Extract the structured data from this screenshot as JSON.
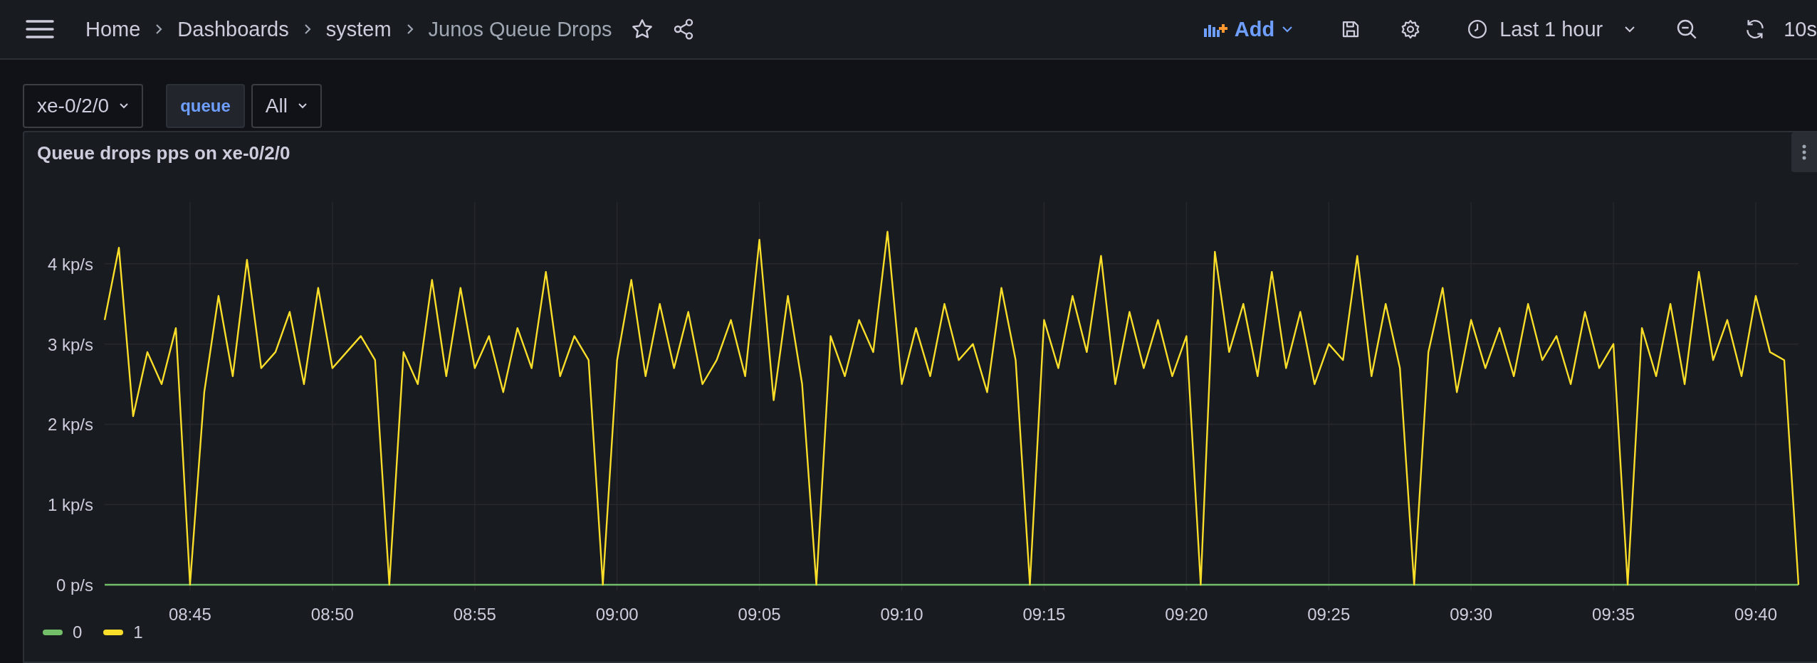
{
  "breadcrumbs": [
    {
      "label": "Home",
      "current": false
    },
    {
      "label": "Dashboards",
      "current": false
    },
    {
      "label": "system",
      "current": false
    },
    {
      "label": "Junos Queue Drops",
      "current": true
    }
  ],
  "toolbar": {
    "add_label": "Add",
    "time_range": "Last 1 hour",
    "refresh_interval": "10s"
  },
  "variables": [
    {
      "value": "xe-0/2/0"
    },
    {
      "label": "queue",
      "value": "All"
    }
  ],
  "panel": {
    "title": "Queue drops pps on xe-0/2/0",
    "chart_data": {
      "type": "line",
      "grid": true,
      "ylim": [
        0,
        4.77
      ],
      "yticks": [
        {
          "value": 0,
          "label": "0 p/s"
        },
        {
          "value": 1,
          "label": "1 kp/s"
        },
        {
          "value": 2,
          "label": "2 kp/s"
        },
        {
          "value": 3,
          "label": "3 kp/s"
        },
        {
          "value": 4,
          "label": "4 kp/s"
        }
      ],
      "categories": [
        null,
        null,
        null,
        null,
        null,
        null,
        "08:45",
        null,
        null,
        null,
        null,
        null,
        null,
        null,
        null,
        null,
        "08:50",
        null,
        null,
        null,
        null,
        null,
        null,
        null,
        null,
        null,
        "08:55",
        null,
        null,
        null,
        null,
        null,
        null,
        null,
        null,
        null,
        "09:00",
        null,
        null,
        null,
        null,
        null,
        null,
        null,
        null,
        null,
        "09:05",
        null,
        null,
        null,
        null,
        null,
        null,
        null,
        null,
        null,
        "09:10",
        null,
        null,
        null,
        null,
        null,
        null,
        null,
        null,
        null,
        "09:15",
        null,
        null,
        null,
        null,
        null,
        null,
        null,
        null,
        null,
        "09:20",
        null,
        null,
        null,
        null,
        null,
        null,
        null,
        null,
        null,
        "09:25",
        null,
        null,
        null,
        null,
        null,
        null,
        null,
        null,
        null,
        "09:30",
        null,
        null,
        null,
        null,
        null,
        null,
        null,
        null,
        null,
        "09:35",
        null,
        null,
        null,
        null,
        null,
        null,
        null,
        null,
        null,
        "09:40",
        null,
        null,
        null
      ],
      "series": [
        {
          "name": "0",
          "color": "#73bf69",
          "values": [
            0,
            0,
            0,
            0,
            0,
            0,
            0,
            0,
            0,
            0,
            0,
            0,
            0,
            0,
            0,
            0,
            0,
            0,
            0,
            0,
            0,
            0,
            0,
            0,
            0,
            0,
            0,
            0,
            0,
            0,
            0,
            0,
            0,
            0,
            0,
            0,
            0,
            0,
            0,
            0,
            0,
            0,
            0,
            0,
            0,
            0,
            0,
            0,
            0,
            0,
            0,
            0,
            0,
            0,
            0,
            0,
            0,
            0,
            0,
            0,
            0,
            0,
            0,
            0,
            0,
            0,
            0,
            0,
            0,
            0,
            0,
            0,
            0,
            0,
            0,
            0,
            0,
            0,
            0,
            0,
            0,
            0,
            0,
            0,
            0,
            0,
            0,
            0,
            0,
            0,
            0,
            0,
            0,
            0,
            0,
            0,
            0,
            0,
            0,
            0,
            0,
            0,
            0,
            0,
            0,
            0,
            0,
            0,
            0,
            0,
            0,
            0,
            0,
            0,
            0,
            0,
            0,
            0,
            0,
            0
          ]
        },
        {
          "name": "1",
          "color": "#fade2a",
          "values": [
            3.3,
            4.2,
            2.1,
            2.9,
            2.5,
            3.2,
            0,
            2.4,
            3.6,
            2.6,
            4.05,
            2.7,
            2.9,
            3.4,
            2.5,
            3.7,
            2.7,
            2.9,
            3.1,
            2.8,
            0,
            2.9,
            2.5,
            3.8,
            2.6,
            3.7,
            2.7,
            3.1,
            2.4,
            3.2,
            2.7,
            3.9,
            2.6,
            3.1,
            2.8,
            0,
            2.8,
            3.8,
            2.6,
            3.5,
            2.7,
            3.4,
            2.5,
            2.8,
            3.3,
            2.6,
            4.3,
            2.3,
            3.6,
            2.5,
            0,
            3.1,
            2.6,
            3.3,
            2.9,
            4.4,
            2.5,
            3.2,
            2.6,
            3.5,
            2.8,
            3,
            2.4,
            3.7,
            2.8,
            0,
            3.3,
            2.7,
            3.6,
            2.9,
            4.1,
            2.5,
            3.4,
            2.7,
            3.3,
            2.6,
            3.1,
            0,
            4.15,
            2.9,
            3.5,
            2.6,
            3.9,
            2.7,
            3.4,
            2.5,
            3,
            2.8,
            4.1,
            2.6,
            3.5,
            2.7,
            0,
            2.9,
            3.7,
            2.4,
            3.3,
            2.7,
            3.2,
            2.6,
            3.5,
            2.8,
            3.1,
            2.5,
            3.4,
            2.7,
            3,
            0,
            3.2,
            2.6,
            3.5,
            2.5,
            3.9,
            2.8,
            3.3,
            2.6,
            3.6,
            2.9,
            2.8,
            0
          ]
        }
      ]
    }
  }
}
